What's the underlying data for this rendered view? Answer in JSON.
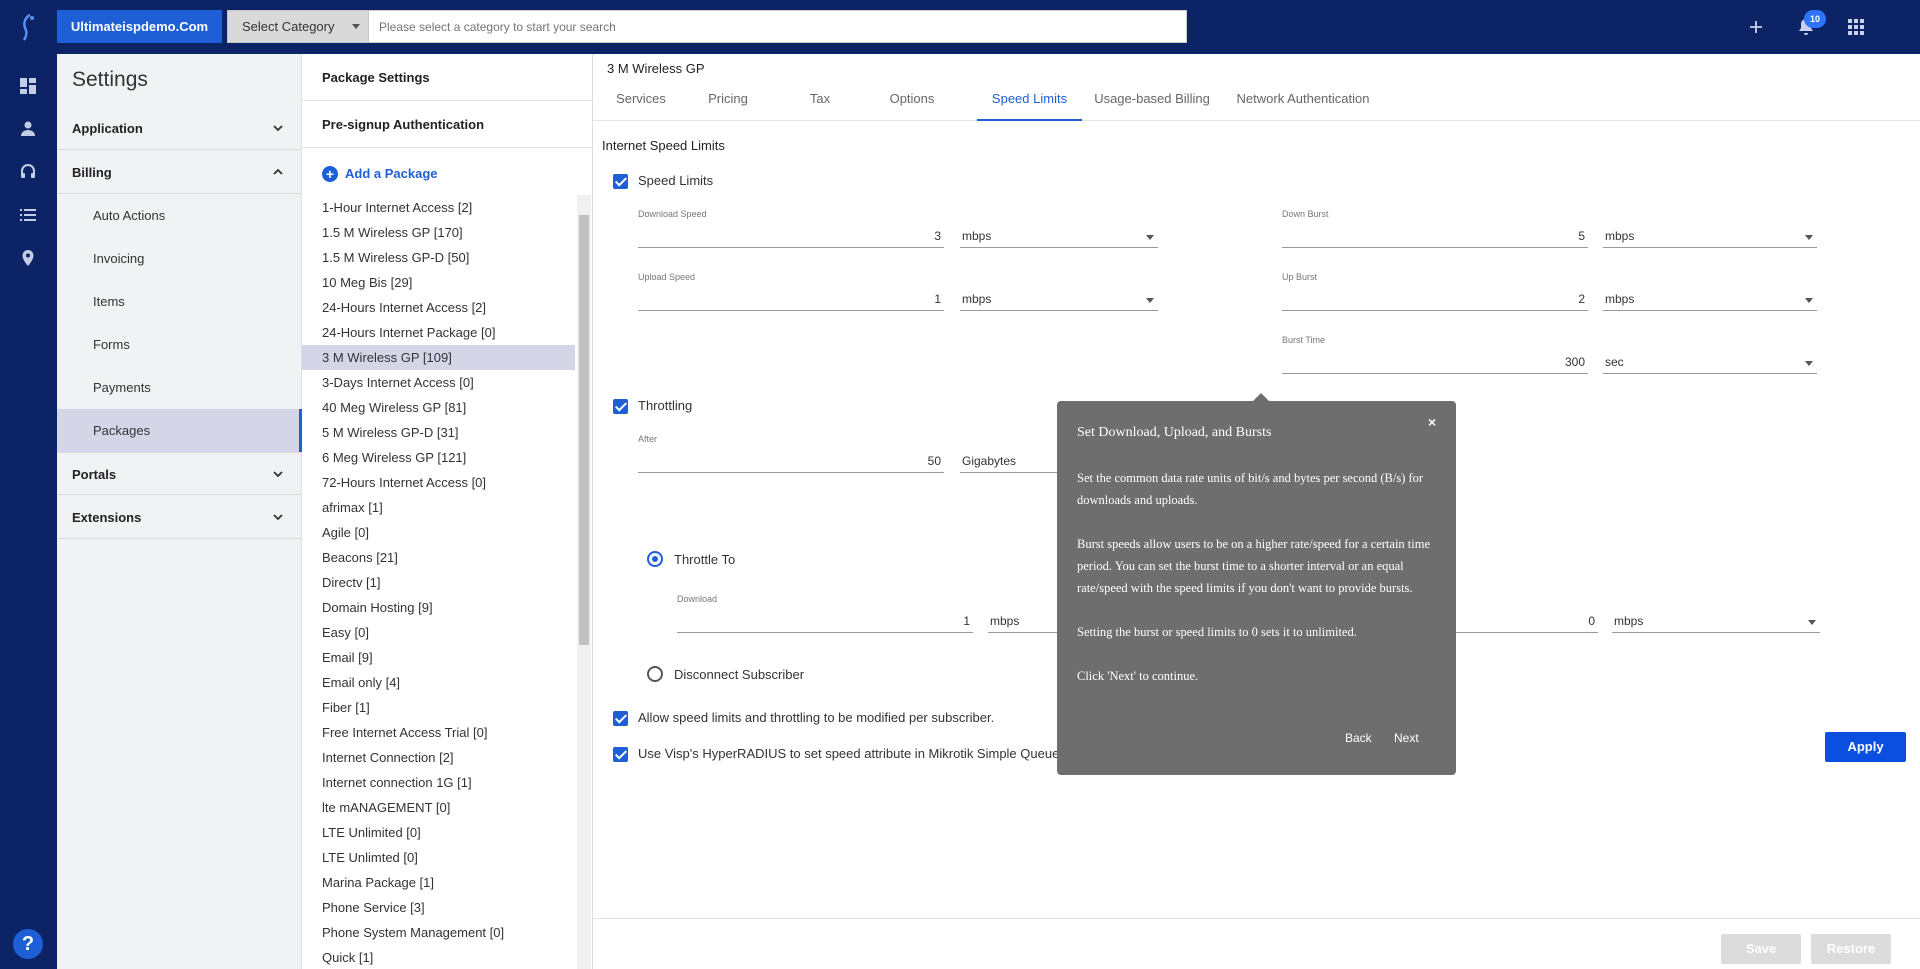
{
  "topbar": {
    "brand": "Ultimateispdemo.Com",
    "category_select": "Select Category",
    "search_placeholder": "Please select a category to start your search",
    "notifications_count": "10"
  },
  "settings": {
    "title": "Settings",
    "sections": {
      "application": "Application",
      "billing": "Billing",
      "portals": "Portals",
      "extensions": "Extensions"
    },
    "billing_items": [
      "Auto Actions",
      "Invoicing",
      "Items",
      "Forms",
      "Payments",
      "Packages"
    ]
  },
  "packages": {
    "package_settings": "Package Settings",
    "pre_signup": "Pre-signup Authentication",
    "add_package": "Add a Package",
    "items": [
      "1-Hour Internet Access [2]",
      "1.5 M Wireless GP [170]",
      "1.5 M Wireless GP-D [50]",
      "10 Meg Bis [29]",
      "24-Hours Internet Access [2]",
      "24-Hours Internet Package [0]",
      "3 M Wireless GP [109]",
      "3-Days Internet Access [0]",
      "40 Meg Wireless GP [81]",
      "5 M Wireless GP-D [31]",
      "6 Meg Wireless GP [121]",
      "72-Hours Internet Access [0]",
      "afrimax [1]",
      "Agile [0]",
      "Beacons [21]",
      "Directv [1]",
      "Domain Hosting [9]",
      "Easy [0]",
      "Email [9]",
      "Email only [4]",
      "Fiber [1]",
      "Free Internet Access Trial [0]",
      "Internet Connection [2]",
      "Internet connection 1G [1]",
      "lte mANAGEMENT [0]",
      "LTE Unlimited [0]",
      "LTE Unlimted [0]",
      "Marina Package [1]",
      "Phone Service [3]",
      "Phone System Management [0]",
      "Quick [1]"
    ]
  },
  "main": {
    "title": "3 M Wireless GP",
    "tabs": [
      "Services",
      "Pricing",
      "Tax",
      "Options",
      "Speed Limits",
      "Usage-based Billing",
      "Network Authentication"
    ],
    "section_title": "Internet Speed Limits",
    "speed_limits_label": "Speed Limits",
    "download_speed": {
      "label": "Download Speed",
      "value": "3",
      "unit": "mbps"
    },
    "upload_speed": {
      "label": "Upload Speed",
      "value": "1",
      "unit": "mbps"
    },
    "down_burst": {
      "label": "Down Burst",
      "value": "5",
      "unit": "mbps"
    },
    "up_burst": {
      "label": "Up Burst",
      "value": "2",
      "unit": "mbps"
    },
    "burst_time": {
      "label": "Burst Time",
      "value": "300",
      "unit": "sec"
    },
    "throttling_label": "Throttling",
    "after": {
      "label": "After",
      "value": "50",
      "unit": "Gigabytes"
    },
    "throttle_to_label": "Throttle To",
    "throttle_download": {
      "label": "Download",
      "value": "1",
      "unit": "mbps"
    },
    "throttle_upload": {
      "value": "0",
      "unit": "mbps"
    },
    "disconnect_label": "Disconnect Subscriber",
    "allow_modify_label": "Allow speed limits and throttling to be modified per subscriber.",
    "hyperradius_label": "Use Visp's HyperRADIUS to set speed attribute in Mikrotik Simple Queue",
    "apply": "Apply",
    "save": "Save",
    "restore": "Restore"
  },
  "tooltip": {
    "title": "Set Download, Upload, and Bursts",
    "close": "×",
    "p1": "Set the common data rate units  of bit/s and bytes per second (B/s) for downloads and uploads.",
    "p2": "Burst speeds allow users to be on a higher rate/speed for a certain time period. You can set the burst time to a shorter interval or an equal rate/speed with the speed limits if you don't want to provide bursts.",
    "p3": "Setting the burst or speed limits to 0 sets it to unlimited.",
    "p4": "Click 'Next' to continue.",
    "back": "Back",
    "next": "Next"
  }
}
